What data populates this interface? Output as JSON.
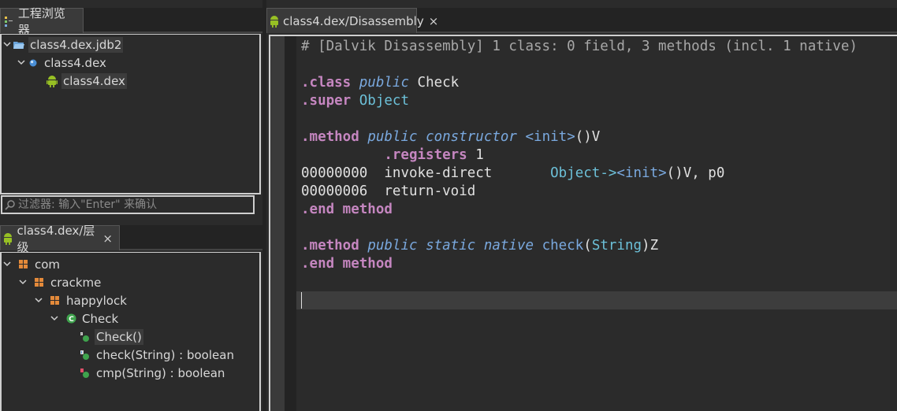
{
  "colors": {
    "background": "#2b2b2b",
    "keyword": "#c586c0",
    "modifier": "#7aa9df",
    "type": "#6cc0d8",
    "selection": "#3c3c3c"
  },
  "project_panel": {
    "tab_label": "工程浏览器",
    "tab_icon": "project-icon",
    "tree": [
      {
        "label": "class4.dex.jdb2",
        "icon": "folder-icon"
      },
      {
        "label": "class4.dex",
        "icon": "dex-icon"
      },
      {
        "label": "class4.dex",
        "icon": "android-icon"
      }
    ],
    "filter_placeholder": "过滤器: 输入\"Enter\" 来确认"
  },
  "hierarchy_panel": {
    "tab_label": "class4.dex/层级",
    "tab_icon": "android-icon",
    "close_icon": "×",
    "tree": [
      {
        "label": "com",
        "icon": "package-icon"
      },
      {
        "label": "crackme",
        "icon": "package-icon"
      },
      {
        "label": "happylock",
        "icon": "package-icon"
      },
      {
        "label": "Check",
        "icon": "class-icon"
      },
      {
        "label": "Check()",
        "icon": "constructor-icon"
      },
      {
        "label": "check(String) : boolean",
        "icon": "native-method-icon"
      },
      {
        "label": "cmp(String) : boolean",
        "icon": "private-method-icon"
      }
    ]
  },
  "editor": {
    "tab_label": "class4.dex/Disassembly",
    "tab_icon": "android-icon",
    "close_icon": "×",
    "code": {
      "header": "# [Dalvik Disassembly] 1 class: 0 field, 3 methods (incl. 1 native)",
      "class_kw": ".class",
      "class_mod": "public",
      "class_name": "Check",
      "super_kw": ".super",
      "super_name": "Object",
      "method_kw": ".method",
      "m1_mods": "public constructor",
      "m1_name": "<init>",
      "m1_sig": "()V",
      "registers_kw": ".registers",
      "registers_val": "1",
      "addr1": "00000000",
      "op1": "invoke-direct",
      "op1_target": "Object->",
      "op1_init": "<init>",
      "op1_rest": "()V, p0",
      "addr2": "00000006",
      "op2": "return-void",
      "end_kw": ".end method",
      "m2_mods": "public static native",
      "m2_name": "check",
      "m2_open": "(",
      "m2_arg": "String",
      "m2_close": ")Z"
    }
  }
}
